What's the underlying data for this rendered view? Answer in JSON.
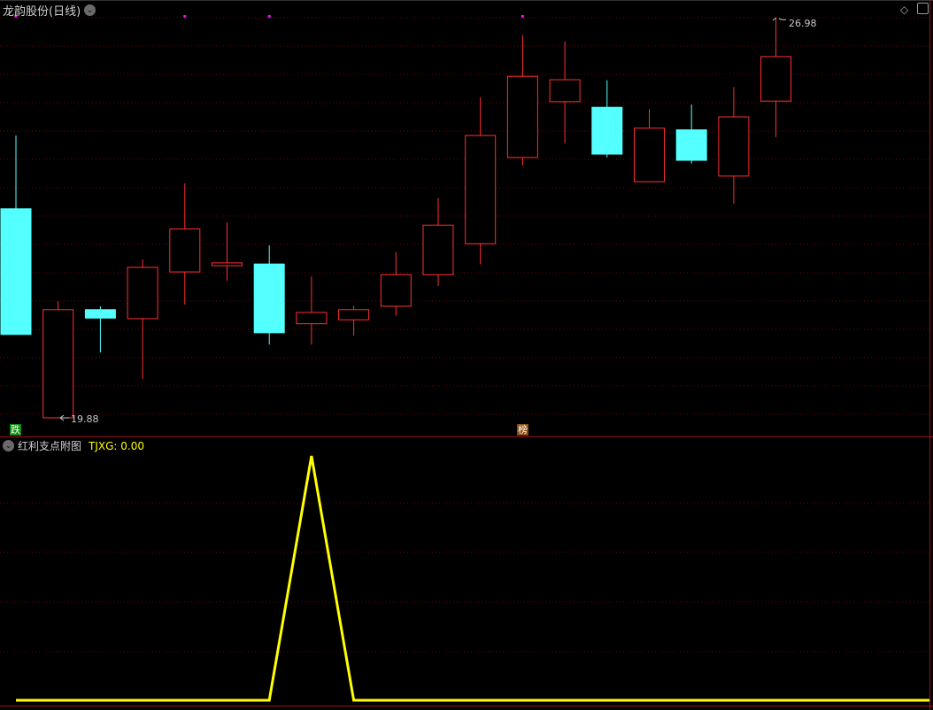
{
  "header": {
    "title": "龙韵股份(日线)"
  },
  "main_chart": {
    "high_label": "26.98",
    "low_label": "19.88",
    "tags": [
      {
        "text": "跌",
        "color": "#118811",
        "candle": 0
      },
      {
        "text": "榜",
        "color": "#8a4a10",
        "candle": 12
      }
    ],
    "marker_candles": [
      0,
      4,
      6,
      12
    ],
    "colors": {
      "up": "#ff3030",
      "down": "#54ffff",
      "grid": "#7a0000",
      "marker": "#ff00ff"
    }
  },
  "sub_chart": {
    "title": "红利支点附图",
    "indicator_label": "TJXG: 0.00",
    "line_color": "#ffff00"
  },
  "chart_data": {
    "type": "candlestick",
    "ylim": [
      19.88,
      26.98
    ],
    "candles": [
      {
        "o": 23.59,
        "h": 24.89,
        "l": 21.36,
        "c": 21.36
      },
      {
        "o": 19.88,
        "h": 21.95,
        "l": 19.88,
        "c": 21.8
      },
      {
        "o": 21.8,
        "h": 21.86,
        "l": 21.04,
        "c": 21.65
      },
      {
        "o": 21.64,
        "h": 22.69,
        "l": 20.57,
        "c": 22.55
      },
      {
        "o": 22.47,
        "h": 24.04,
        "l": 21.89,
        "c": 23.23
      },
      {
        "o": 22.58,
        "h": 23.35,
        "l": 22.31,
        "c": 22.63
      },
      {
        "o": 22.61,
        "h": 22.94,
        "l": 21.18,
        "c": 21.39
      },
      {
        "o": 21.55,
        "h": 22.39,
        "l": 21.18,
        "c": 21.75
      },
      {
        "o": 21.62,
        "h": 21.87,
        "l": 21.34,
        "c": 21.8
      },
      {
        "o": 21.86,
        "h": 22.82,
        "l": 21.69,
        "c": 22.42
      },
      {
        "o": 22.42,
        "h": 23.78,
        "l": 22.22,
        "c": 23.3
      },
      {
        "o": 22.97,
        "h": 25.57,
        "l": 22.6,
        "c": 24.89
      },
      {
        "o": 24.5,
        "h": 26.67,
        "l": 24.36,
        "c": 25.94
      },
      {
        "o": 25.49,
        "h": 26.56,
        "l": 24.75,
        "c": 25.88
      },
      {
        "o": 25.39,
        "h": 25.87,
        "l": 24.5,
        "c": 24.56
      },
      {
        "o": 24.07,
        "h": 25.36,
        "l": 24.07,
        "c": 25.02
      },
      {
        "o": 24.99,
        "h": 25.44,
        "l": 24.39,
        "c": 24.45
      },
      {
        "o": 24.17,
        "h": 25.75,
        "l": 23.68,
        "c": 25.22
      },
      {
        "o": 25.5,
        "h": 26.98,
        "l": 24.86,
        "c": 26.29
      }
    ],
    "tjxg": [
      0,
      0,
      0,
      0,
      0,
      0,
      0,
      1,
      0,
      0,
      0,
      0,
      0,
      0,
      0,
      0,
      0,
      0,
      0,
      0,
      0,
      0
    ]
  }
}
